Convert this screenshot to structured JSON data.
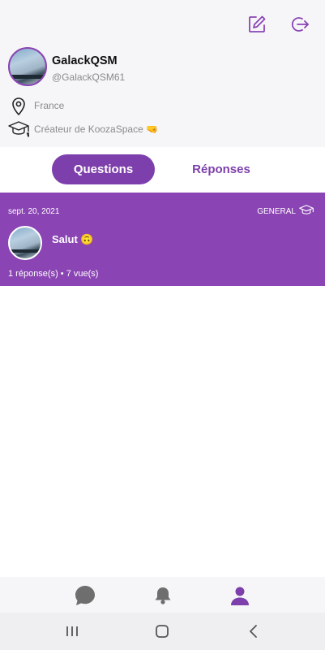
{
  "header": {
    "edit_icon": "edit-square-icon",
    "logout_icon": "logout-icon"
  },
  "profile": {
    "username": "GalackQSM",
    "handle": "@GalackQSM61",
    "location": "France",
    "bio": "Créateur de KoozaSpace 🤜"
  },
  "tabs": {
    "questions": "Questions",
    "answers": "Réponses"
  },
  "question": {
    "date": "sept. 20, 2021",
    "category": "GENERAL",
    "title": "Salut 🙃",
    "stats": "1 réponse(s) • 7 vue(s)"
  },
  "bottom_nav": {
    "items": [
      "chat-bubble-icon",
      "bell-icon",
      "user-icon"
    ],
    "active_color": "#7d3fab",
    "inactive_color": "#6e6e6e"
  },
  "colors": {
    "accent": "#8a44b3",
    "tab_active": "#7d3fab"
  }
}
